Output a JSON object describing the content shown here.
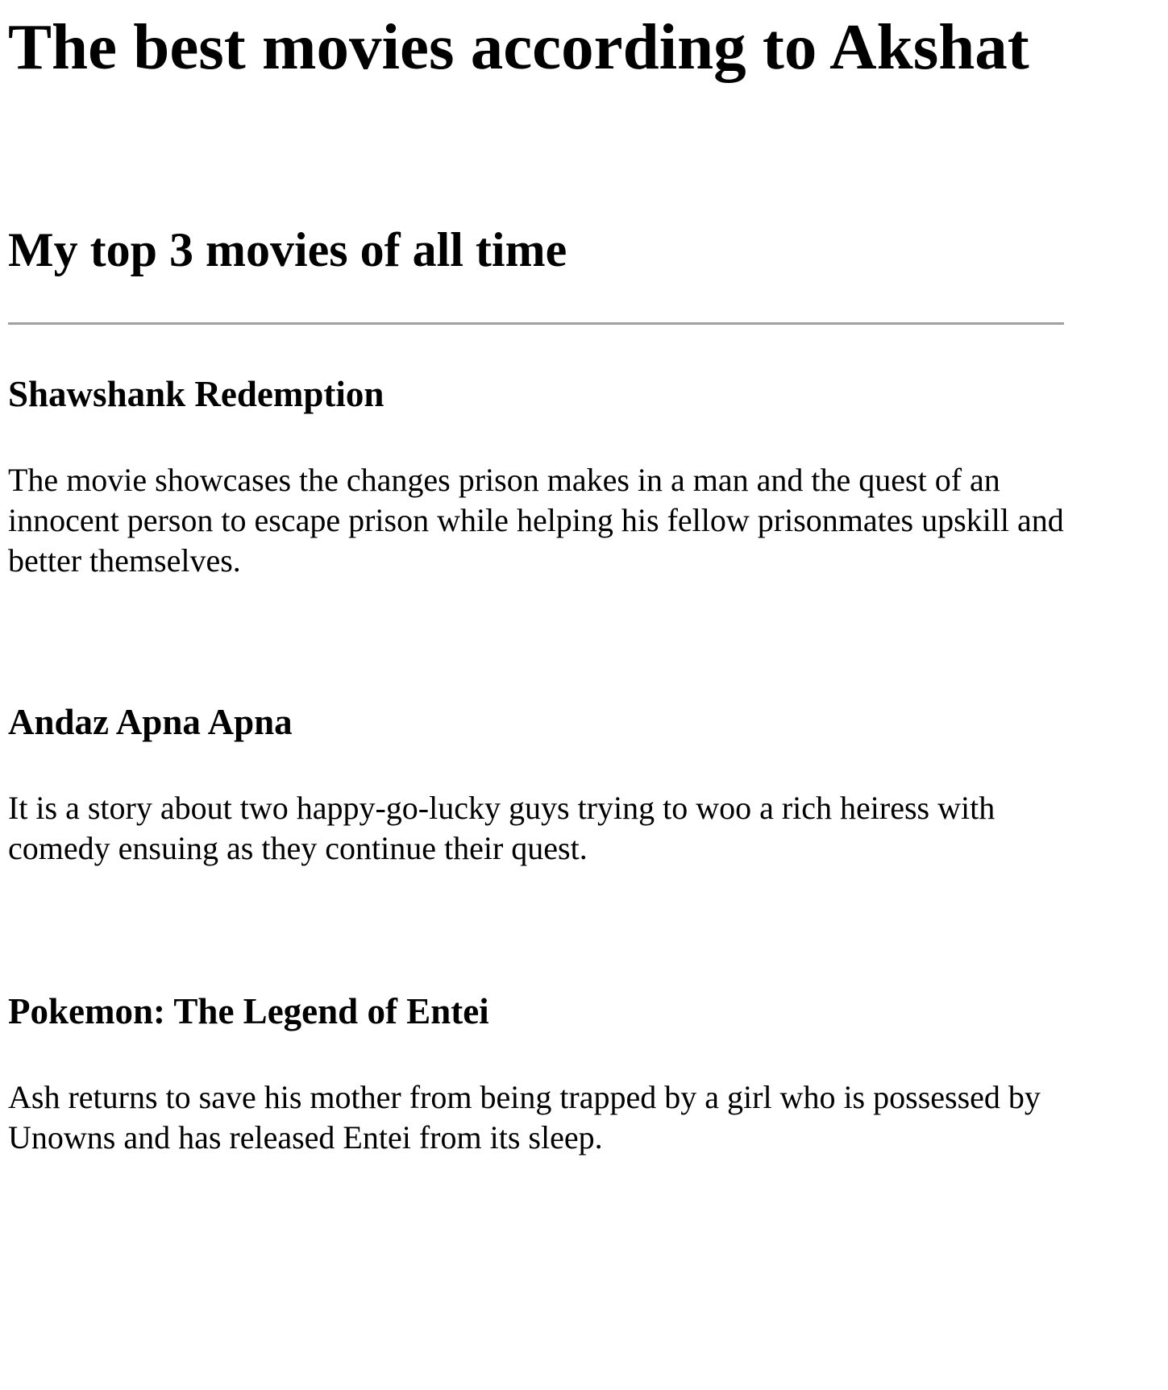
{
  "page": {
    "title": "The best movies according to Akshat",
    "section_heading": "My top 3 movies of all time"
  },
  "movies": [
    {
      "title": "Shawshank Redemption",
      "description": "The movie showcases the changes prison makes in a man and the quest of an innocent person to escape prison while helping his fellow prisonmates upskill and better themselves."
    },
    {
      "title": "Andaz Apna Apna",
      "description": "It is a story about two happy-go-lucky guys trying to woo a rich heiress with comedy ensuing as they continue their quest."
    },
    {
      "title": "Pokemon: The Legend of Entei",
      "description": "Ash returns to save his mother from being trapped by a girl who is possessed by Unowns and has released Entei from its sleep."
    }
  ],
  "colors": {
    "text": "#000000",
    "divider": "#a0a0a0",
    "background": "#ffffff"
  }
}
